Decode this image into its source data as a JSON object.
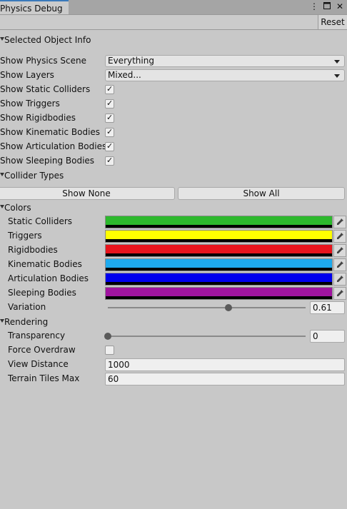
{
  "window": {
    "tab_title": "Physics Debug",
    "icons": {
      "menu": "kebab-menu-icon",
      "maximize": "maximize-icon",
      "close": "close-icon"
    }
  },
  "toolbar": {
    "reset_label": "Reset"
  },
  "selected_object": {
    "label": "Selected Object Info"
  },
  "filters": {
    "physics_scene": {
      "label": "Show Physics Scene",
      "value": "Everything"
    },
    "layers": {
      "label": "Show Layers",
      "value": "Mixed..."
    },
    "toggles": [
      {
        "label": "Show Static Colliders",
        "checked": true
      },
      {
        "label": "Show Triggers",
        "checked": true
      },
      {
        "label": "Show Rigidbodies",
        "checked": true
      },
      {
        "label": "Show Kinematic Bodies",
        "checked": true
      },
      {
        "label": "Show Articulation Bodies",
        "checked": true
      },
      {
        "label": "Show Sleeping Bodies",
        "checked": true
      }
    ],
    "collider_types_label": "Collider Types",
    "show_none_label": "Show None",
    "show_all_label": "Show All"
  },
  "colors": {
    "header": "Colors",
    "items": [
      {
        "label": "Static Colliders",
        "color": "#2db92d"
      },
      {
        "label": "Triggers",
        "color": "#ffff00"
      },
      {
        "label": "Rigidbodies",
        "color": "#e8141c"
      },
      {
        "label": "Kinematic Bodies",
        "color": "#1eaaee"
      },
      {
        "label": "Articulation Bodies",
        "color": "#0000ee"
      },
      {
        "label": "Sleeping Bodies",
        "color": "#a014a0"
      }
    ],
    "variation": {
      "label": "Variation",
      "value": "0.61",
      "fraction": 0.61
    }
  },
  "rendering": {
    "header": "Rendering",
    "transparency": {
      "label": "Transparency",
      "value": "0",
      "fraction": 0
    },
    "force_overdraw": {
      "label": "Force Overdraw",
      "checked": false
    },
    "view_distance": {
      "label": "View Distance",
      "value": "1000"
    },
    "terrain_tiles_max": {
      "label": "Terrain Tiles Max",
      "value": "60"
    }
  }
}
